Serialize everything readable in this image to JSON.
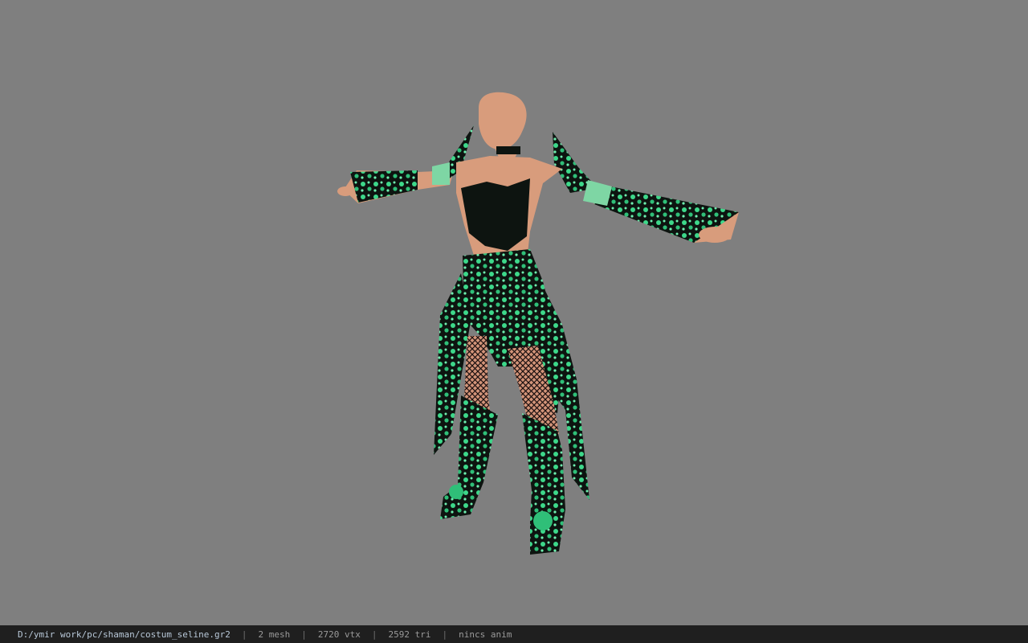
{
  "viewer": {
    "background_color": "#7f7f7f",
    "model_description": "t-pose character with green floral armor"
  },
  "status": {
    "file_path": "D:/ymir work/pc/shaman/costum_seline.gr2",
    "mesh_count": "2 mesh",
    "vertex_count": "2720 vtx",
    "triangle_count": "2592 tri",
    "anim": "nincs anim",
    "separator": "|"
  },
  "colors": {
    "skin": "#d89c7c",
    "armor_dark": "#0d1410",
    "armor_green": "#3dd88a",
    "statusbar_bg": "#1f1f1f"
  }
}
